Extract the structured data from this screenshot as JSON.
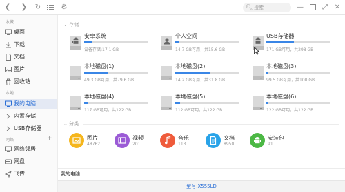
{
  "toolbar": {
    "search_placeholder": "搜索"
  },
  "sidebar": {
    "sections": [
      {
        "title": "收藏",
        "items": [
          {
            "label": "桌面",
            "icon": "desktop-icon"
          },
          {
            "label": "下载",
            "icon": "download-icon"
          },
          {
            "label": "文档",
            "icon": "document-icon"
          },
          {
            "label": "图片",
            "icon": "image-icon"
          },
          {
            "label": "回收站",
            "icon": "trash-icon"
          }
        ]
      },
      {
        "title": "本地",
        "items": [
          {
            "label": "我的电脑",
            "icon": "computer-icon",
            "active": true
          },
          {
            "label": "内置存储",
            "icon": "internal-storage-icon"
          },
          {
            "label": "USB存储器",
            "icon": "usb-icon"
          }
        ]
      },
      {
        "title": "网络",
        "items": [
          {
            "label": "网络邻居",
            "icon": "network-neighbors-icon"
          },
          {
            "label": "网盘",
            "icon": "cloud-drive-icon"
          },
          {
            "label": "飞传",
            "icon": "transfer-icon"
          }
        ]
      }
    ]
  },
  "storage": {
    "title": "存储",
    "drives": [
      {
        "name": "安卓系统",
        "info": "设备存储:17.1 GB",
        "fill": 0.12,
        "icon": "android-drive-icon"
      },
      {
        "name": "个人空间",
        "info": "14.7 GB可用，共15.6 GB",
        "fill": 0.06,
        "icon": "user-drive-icon"
      },
      {
        "name": "USB存储器",
        "info": "171 GB可用，共298 GB",
        "fill": 0.43,
        "icon": "usb-drive-icon"
      },
      {
        "name": "本地磁盘(1)",
        "info": "49.3 GB可用，共79.6 GB",
        "fill": 0.38,
        "icon": "hdd-icon"
      },
      {
        "name": "本地磁盘(2)",
        "info": "14.2 GB可用，共31.8 GB",
        "fill": 0.55,
        "icon": "hdd-icon"
      },
      {
        "name": "本地磁盘(3)",
        "info": "99.5 GB可用，共100 GB",
        "fill": 0.03,
        "icon": "hdd-icon"
      },
      {
        "name": "本地磁盘(4)",
        "info": "117 GB可用，共122 GB",
        "fill": 0.05,
        "icon": "hdd-icon"
      },
      {
        "name": "本地磁盘(5)",
        "info": "112 GB可用，共122 GB",
        "fill": 0.08,
        "icon": "hdd-icon"
      },
      {
        "name": "本地磁盘(6)",
        "info": "122 GB可用，共122 GB",
        "fill": 0.02,
        "icon": "hdd-icon"
      }
    ]
  },
  "categories": {
    "title": "分类",
    "items": [
      {
        "name": "图片",
        "count": "48762",
        "color": "#f5b61d",
        "icon": "picture-category-icon"
      },
      {
        "name": "视频",
        "count": "201",
        "color": "#9b5bd6",
        "icon": "video-category-icon"
      },
      {
        "name": "音乐",
        "count": "113",
        "color": "#ef5b3b",
        "icon": "music-category-icon"
      },
      {
        "name": "文档",
        "count": "8950",
        "color": "#29a3e8",
        "icon": "document-category-icon"
      },
      {
        "name": "安装包",
        "count": "91",
        "color": "#4cb845",
        "icon": "package-category-icon"
      }
    ]
  },
  "status": {
    "location": "我的电脑",
    "model": "型号:X555LD"
  },
  "colors": {
    "accent": "#2b6fd6",
    "bar_fill": "#3a86e6"
  }
}
